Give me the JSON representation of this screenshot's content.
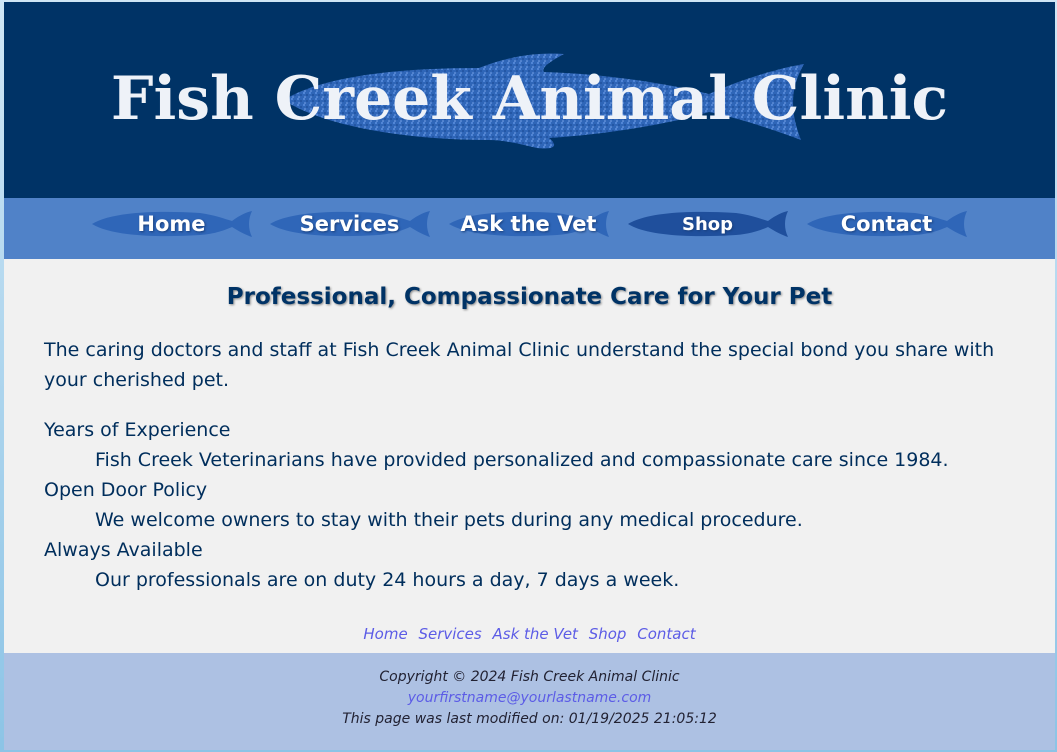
{
  "header": {
    "title": "Fish Creek Animal Clinic"
  },
  "nav": {
    "items": [
      {
        "label": "Home"
      },
      {
        "label": "Services"
      },
      {
        "label": "Ask the Vet"
      },
      {
        "label": "Shop"
      },
      {
        "label": "Contact"
      }
    ]
  },
  "main": {
    "heading": "Professional, Compassionate Care for Your Pet",
    "intro": "The caring doctors and staff at Fish Creek Animal Clinic understand the special bond you share with your cherished pet.",
    "features": [
      {
        "term": "Years of Experience",
        "desc": "Fish Creek Veterinarians have provided personalized and compassionate care since 1984."
      },
      {
        "term": "Open Door Policy",
        "desc": "We welcome owners to stay with their pets during any medical procedure."
      },
      {
        "term": "Always Available",
        "desc": "Our professionals are on duty 24 hours a day, 7 days a week."
      }
    ]
  },
  "text_nav": {
    "items": [
      "Home",
      "Services",
      "Ask the Vet",
      "Shop",
      "Contact"
    ]
  },
  "footer": {
    "copyright": "Copyright © 2024 Fish Creek Animal Clinic",
    "email": "yourfirstname@yourlastname.com",
    "modified": "This page was last modified on: 01/19/2025 21:05:12"
  },
  "colors": {
    "header_bg": "#003366",
    "nav_bg": "#5082c8",
    "content_bg": "#f1f1f1",
    "footer_bg": "#adc1e3",
    "link": "#5c5ce6"
  },
  "icons": [
    "fish-logo-icon",
    "fish-nav-icon"
  ]
}
